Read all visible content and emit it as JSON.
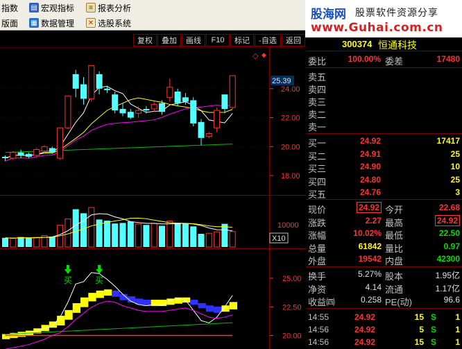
{
  "menu": {
    "items": [
      {
        "label": "指数",
        "icon": "none"
      },
      {
        "label": "宏观指标",
        "icon": "chart-icon"
      },
      {
        "label": "报表分析",
        "icon": "report-icon"
      },
      {
        "label": "版面",
        "icon": "none"
      },
      {
        "label": "数据管理",
        "icon": "data-icon"
      },
      {
        "label": "选股系统",
        "icon": "select-icon"
      }
    ]
  },
  "banner": {
    "logo": "股海网",
    "slogan": "股票软件资源分享",
    "url": "www.Guhai.com.cn"
  },
  "toolbar": {
    "buttons": [
      "复权",
      "叠加",
      "画线",
      "F10",
      "标记",
      "-自选",
      "返回"
    ]
  },
  "chart": {
    "price_label_current": "25.39",
    "price_ticks": [
      "24.00",
      "22.00",
      "20.00",
      "18.00"
    ],
    "volume_tick": "10000",
    "volume_unit": "X10",
    "indicator_ticks": [
      "25.00",
      "22.50",
      "20.00"
    ],
    "buy_signal_text": "买",
    "colors": {
      "up": "#ff3232",
      "down": "#54ffff",
      "ma5": "#ffffff",
      "ma10": "#ffff00",
      "ma20": "#ff00ff",
      "ma60": "#00c000",
      "grid": "#800000"
    }
  },
  "chart_data": {
    "type": "candlestick",
    "ylim": [
      17.0,
      26.0
    ],
    "candles": [
      {
        "o": 19.3,
        "c": 19.2,
        "h": 19.4,
        "l": 19.0
      },
      {
        "o": 19.2,
        "c": 19.6,
        "h": 19.7,
        "l": 19.1
      },
      {
        "o": 19.6,
        "c": 19.4,
        "h": 19.8,
        "l": 19.2
      },
      {
        "o": 19.5,
        "c": 19.3,
        "h": 19.6,
        "l": 19.2
      },
      {
        "o": 19.4,
        "c": 19.8,
        "h": 19.9,
        "l": 19.3
      },
      {
        "o": 19.7,
        "c": 20.0,
        "h": 20.1,
        "l": 19.6
      },
      {
        "o": 19.9,
        "c": 19.6,
        "h": 20.0,
        "l": 19.5
      },
      {
        "o": 19.2,
        "c": 21.3,
        "h": 21.3,
        "l": 19.1
      },
      {
        "o": 21.3,
        "c": 23.5,
        "h": 23.5,
        "l": 21.2
      },
      {
        "o": 25.0,
        "c": 24.0,
        "h": 25.3,
        "l": 23.4
      },
      {
        "o": 24.3,
        "c": 23.3,
        "h": 24.8,
        "l": 22.9
      },
      {
        "o": 23.3,
        "c": 25.6,
        "h": 25.6,
        "l": 23.1
      },
      {
        "o": 25.0,
        "c": 24.0,
        "h": 25.2,
        "l": 23.6
      },
      {
        "o": 24.0,
        "c": 23.9,
        "h": 24.2,
        "l": 23.7
      },
      {
        "o": 23.6,
        "c": 22.5,
        "h": 23.8,
        "l": 22.3
      },
      {
        "o": 22.6,
        "c": 22.3,
        "h": 23.0,
        "l": 22.1
      },
      {
        "o": 22.4,
        "c": 22.0,
        "h": 22.6,
        "l": 21.9
      },
      {
        "o": 22.3,
        "c": 22.5,
        "h": 22.8,
        "l": 22.0
      },
      {
        "o": 22.6,
        "c": 22.5,
        "h": 22.8,
        "l": 22.3
      },
      {
        "o": 22.6,
        "c": 22.9,
        "h": 23.1,
        "l": 22.4
      },
      {
        "o": 23.0,
        "c": 22.4,
        "h": 23.2,
        "l": 22.2
      },
      {
        "o": 23.4,
        "c": 24.1,
        "h": 24.7,
        "l": 23.1
      },
      {
        "o": 23.8,
        "c": 23.0,
        "h": 24.0,
        "l": 22.8
      },
      {
        "o": 23.4,
        "c": 23.1,
        "h": 23.7,
        "l": 22.9
      },
      {
        "o": 23.2,
        "c": 21.6,
        "h": 23.4,
        "l": 21.4
      },
      {
        "o": 21.7,
        "c": 20.6,
        "h": 21.9,
        "l": 20.1
      },
      {
        "o": 20.7,
        "c": 20.9,
        "h": 21.0,
        "l": 20.6
      },
      {
        "o": 21.3,
        "c": 22.5,
        "h": 22.7,
        "l": 21.0
      },
      {
        "o": 23.6,
        "c": 22.6,
        "h": 23.6,
        "l": 22.3
      },
      {
        "o": 22.7,
        "c": 24.9,
        "h": 24.9,
        "l": 22.6
      }
    ],
    "volumes": [
      3200,
      3000,
      3500,
      3100,
      3400,
      4000,
      3600,
      7600,
      9800,
      13200,
      11800,
      13800,
      9600,
      9200,
      8200,
      8400,
      8900,
      8100,
      7700,
      8200,
      7400,
      9100,
      8400,
      8200,
      7200,
      4600,
      4800,
      5300,
      8100,
      5400
    ],
    "volume_ylim": [
      0,
      16000
    ],
    "indicator_ylim": [
      19.0,
      27.0
    ],
    "indicator_line": [
      20.0,
      20.2,
      20.1,
      20.2,
      20.4,
      20.6,
      20.8,
      21.6,
      22.9,
      24.5,
      24.7,
      25.5,
      25.4,
      24.9,
      24.3,
      23.6,
      23.0,
      22.7,
      22.6,
      22.7,
      22.6,
      23.1,
      23.2,
      23.1,
      22.2,
      21.3,
      21.1,
      21.6,
      22.5,
      23.5
    ],
    "indicator_band_hi": [
      20.0,
      20.1,
      20.2,
      20.3,
      20.5,
      20.8,
      21.1,
      21.6,
      22.1,
      22.7,
      23.2,
      23.6,
      23.8,
      23.9,
      23.8,
      23.5,
      23.3,
      23.1,
      23.0,
      23.0,
      23.0,
      23.1,
      23.2,
      23.2,
      23.0,
      22.7,
      22.5,
      22.4,
      22.5,
      22.8
    ],
    "indicator_band_lo": [
      19.8,
      19.9,
      20.0,
      20.1,
      20.3,
      20.5,
      20.8,
      21.0,
      21.5,
      22.1,
      22.6,
      23.1,
      23.4,
      23.6,
      23.5,
      23.2,
      23.0,
      22.8,
      22.7,
      22.7,
      22.7,
      22.8,
      22.9,
      23.0,
      22.8,
      22.5,
      22.2,
      22.1,
      22.2,
      22.4
    ]
  },
  "quote": {
    "code": "300374",
    "name": "恒通科技",
    "weibi_label": "委比",
    "weibi_value": "100.00%",
    "weicha_label": "委差",
    "weicha_value": "17480",
    "sells": [
      {
        "label": "卖五",
        "price": "",
        "vol": ""
      },
      {
        "label": "卖四",
        "price": "",
        "vol": ""
      },
      {
        "label": "卖三",
        "price": "",
        "vol": ""
      },
      {
        "label": "卖二",
        "price": "",
        "vol": ""
      },
      {
        "label": "卖一",
        "price": "",
        "vol": ""
      }
    ],
    "buys": [
      {
        "label": "买一",
        "price": "24.92",
        "vol": "17417"
      },
      {
        "label": "买二",
        "price": "24.91",
        "vol": "25"
      },
      {
        "label": "买三",
        "price": "24.90",
        "vol": "10"
      },
      {
        "label": "买四",
        "price": "24.80",
        "vol": "25"
      },
      {
        "label": "买五",
        "price": "24.76",
        "vol": "3"
      }
    ],
    "stats": [
      {
        "l1": "现价",
        "v1": "24.92",
        "c1": "red",
        "b1": true,
        "l2": "今开",
        "v2": "22.68",
        "c2": "red",
        "b2": false
      },
      {
        "l1": "涨跌",
        "v1": "2.27",
        "c1": "red",
        "b1": false,
        "l2": "最高",
        "v2": "24.92",
        "c2": "red",
        "b2": true
      },
      {
        "l1": "涨幅",
        "v1": "10.02%",
        "c1": "red",
        "b1": false,
        "l2": "最低",
        "v2": "22.50",
        "c2": "grn",
        "b2": false
      },
      {
        "l1": "总量",
        "v1": "61842",
        "c1": "yel",
        "b1": false,
        "l2": "量比",
        "v2": "0.97",
        "c2": "grn",
        "b2": false
      },
      {
        "l1": "外盘",
        "v1": "19542",
        "c1": "red",
        "b1": false,
        "l2": "内盘",
        "v2": "42300",
        "c2": "grn",
        "b2": false
      }
    ],
    "stats2": [
      {
        "l1": "换手",
        "v1": "5.27%",
        "l2": "股本",
        "v2": "1.95亿"
      },
      {
        "l1": "净资",
        "v1": "4.14",
        "l2": "流通",
        "v2": "1.17亿"
      },
      {
        "l1": "收益㈣",
        "v1": "0.258",
        "l2": "PE(动)",
        "v2": "96.6"
      }
    ],
    "ticks": [
      {
        "time": "14:55",
        "price": "24.92",
        "vol": "15",
        "bs": "S",
        "n": "1"
      },
      {
        "time": "14:56",
        "price": "24.92",
        "vol": "5",
        "bs": "S",
        "n": "1"
      },
      {
        "time": "14:56",
        "price": "24.92",
        "vol": "15",
        "bs": "S",
        "n": "1"
      }
    ]
  }
}
